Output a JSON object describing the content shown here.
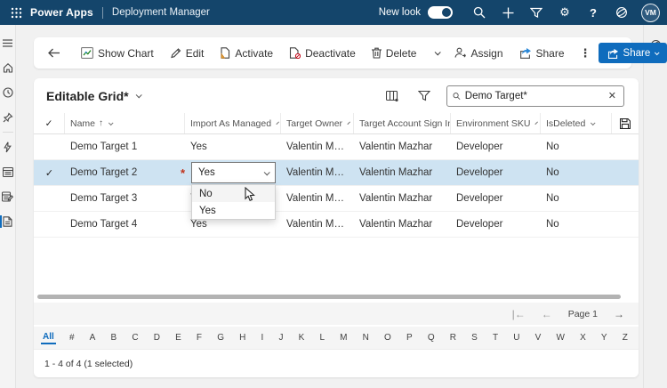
{
  "colors": {
    "topbar": "#14456b",
    "accent": "#0f6cbd",
    "selected_row": "#cee3f2",
    "danger": "#c50f1f"
  },
  "topbar": {
    "app": "Power Apps",
    "module": "Deployment Manager",
    "new_look": "New look",
    "avatar": "VM"
  },
  "sidebar": {
    "items": [
      "menu",
      "home",
      "recent",
      "pinned",
      "flows",
      "tables",
      "editable-grid",
      "deployment-targets"
    ],
    "active": "deployment-targets"
  },
  "toolbar": {
    "show_chart": "Show Chart",
    "edit": "Edit",
    "activate": "Activate",
    "deactivate": "Deactivate",
    "delete": "Delete",
    "assign": "Assign",
    "share": "Share",
    "share_button": "Share"
  },
  "view": {
    "title": "Editable Grid*",
    "search_value": "Demo Target*"
  },
  "grid": {
    "columns": [
      {
        "key": "name",
        "label": "Name",
        "sorted": true
      },
      {
        "key": "import_as_managed",
        "label": "Import As Managed"
      },
      {
        "key": "target_owner",
        "label": "Target Owner"
      },
      {
        "key": "target_account_sign_in",
        "label": "Target Account Sign In"
      },
      {
        "key": "environment_sku",
        "label": "Environment SKU"
      },
      {
        "key": "is_deleted",
        "label": "IsDeleted"
      }
    ],
    "rows": [
      {
        "name": "Demo Target 1",
        "import_as_managed": "Yes",
        "target_owner": "Valentin Maz...",
        "target_account_sign_in": "Valentin Mazhar",
        "environment_sku": "Developer",
        "is_deleted": "No",
        "selected": false,
        "editing": false
      },
      {
        "name": "Demo Target 2",
        "import_as_managed": "Yes",
        "target_owner": "Valentin Maz...",
        "target_account_sign_in": "Valentin Mazhar",
        "environment_sku": "Developer",
        "is_deleted": "No",
        "selected": true,
        "editing": true
      },
      {
        "name": "Demo Target 3",
        "import_as_managed": "Yes",
        "target_owner": "Valentin Maz...",
        "target_account_sign_in": "Valentin Mazhar",
        "environment_sku": "Developer",
        "is_deleted": "No",
        "selected": false,
        "editing": false
      },
      {
        "name": "Demo Target 4",
        "import_as_managed": "Yes",
        "target_owner": "Valentin Maz...",
        "target_account_sign_in": "Valentin Mazhar",
        "environment_sku": "Developer",
        "is_deleted": "No",
        "selected": false,
        "editing": false
      }
    ],
    "editor": {
      "value": "Yes",
      "options": [
        "No",
        "Yes"
      ],
      "hovered_option": "No"
    }
  },
  "pagination": {
    "page": "Page 1"
  },
  "jumpbar": {
    "items": [
      "All",
      "#",
      "A",
      "B",
      "C",
      "D",
      "E",
      "F",
      "G",
      "H",
      "I",
      "J",
      "K",
      "L",
      "M",
      "N",
      "O",
      "P",
      "Q",
      "R",
      "S",
      "T",
      "U",
      "V",
      "W",
      "X",
      "Y",
      "Z"
    ],
    "active": "All"
  },
  "status": {
    "text": "1 - 4 of 4 (1 selected)"
  }
}
